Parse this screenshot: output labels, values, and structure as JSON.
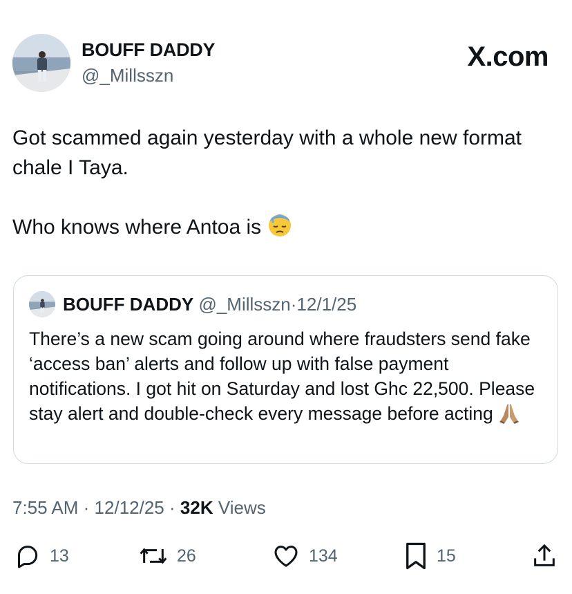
{
  "author": {
    "name": "BOUFF DADDY",
    "handle": "@_Millsszn",
    "avatar_icon": "profile-photo-man-on-boat"
  },
  "brand": {
    "label": "X.com"
  },
  "tweet": {
    "paragraphs": [
      "Got scammed again yesterday with a whole new format chale I Taya.",
      "Who knows where Antoa is"
    ],
    "emoji": "downcast-face-with-sweat"
  },
  "quote": {
    "name": "BOUFF DADDY",
    "handle": "@_Millsszn",
    "separator": "·",
    "date": "12/1/25",
    "text": "There’s a new scam going around where fraudsters send fake ‘access ban’ alerts and follow up with false payment notifications. I got hit on Saturday and lost Ghc 22,500. Please stay alert and double-check every message before acting",
    "emoji": "folded-hands"
  },
  "meta": {
    "time": "7:55 AM",
    "separator": "·",
    "date": "12/12/25",
    "views_count": "32K",
    "views_label": "Views"
  },
  "actions": {
    "replies": "13",
    "reposts": "26",
    "likes": "134",
    "bookmarks": "15"
  },
  "colors": {
    "text": "#0f1419",
    "secondary": "#536471",
    "border": "#cfd9de",
    "background": "#ffffff"
  }
}
